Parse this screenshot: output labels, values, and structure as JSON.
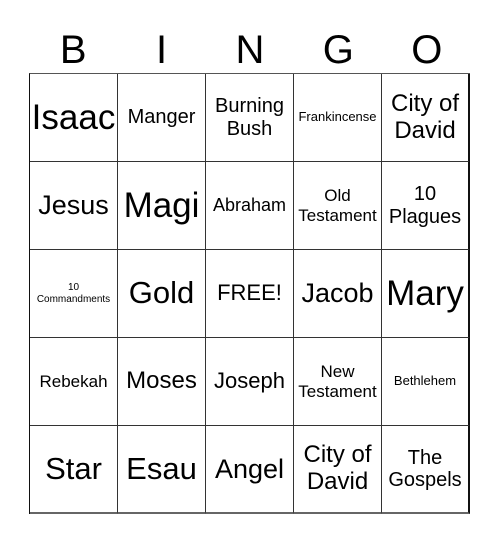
{
  "title_letters": [
    "B",
    "I",
    "N",
    "G",
    "O"
  ],
  "card": {
    "rows": [
      [
        "Isaac",
        "Manger",
        "Burning Bush",
        "Frankincense",
        "City of David"
      ],
      [
        "Jesus",
        "Magi",
        "Abraham",
        "Old Testament",
        "10 Plagues"
      ],
      [
        "10 Commandments",
        "Gold",
        "FREE!",
        "Jacob",
        "Mary"
      ],
      [
        "Rebekah",
        "Moses",
        "Joseph",
        "New Testament",
        "Bethlehem"
      ],
      [
        "Star",
        "Esau",
        "Angel",
        "City of David",
        "The Gospels"
      ]
    ],
    "free_space_label": "FREE!"
  }
}
